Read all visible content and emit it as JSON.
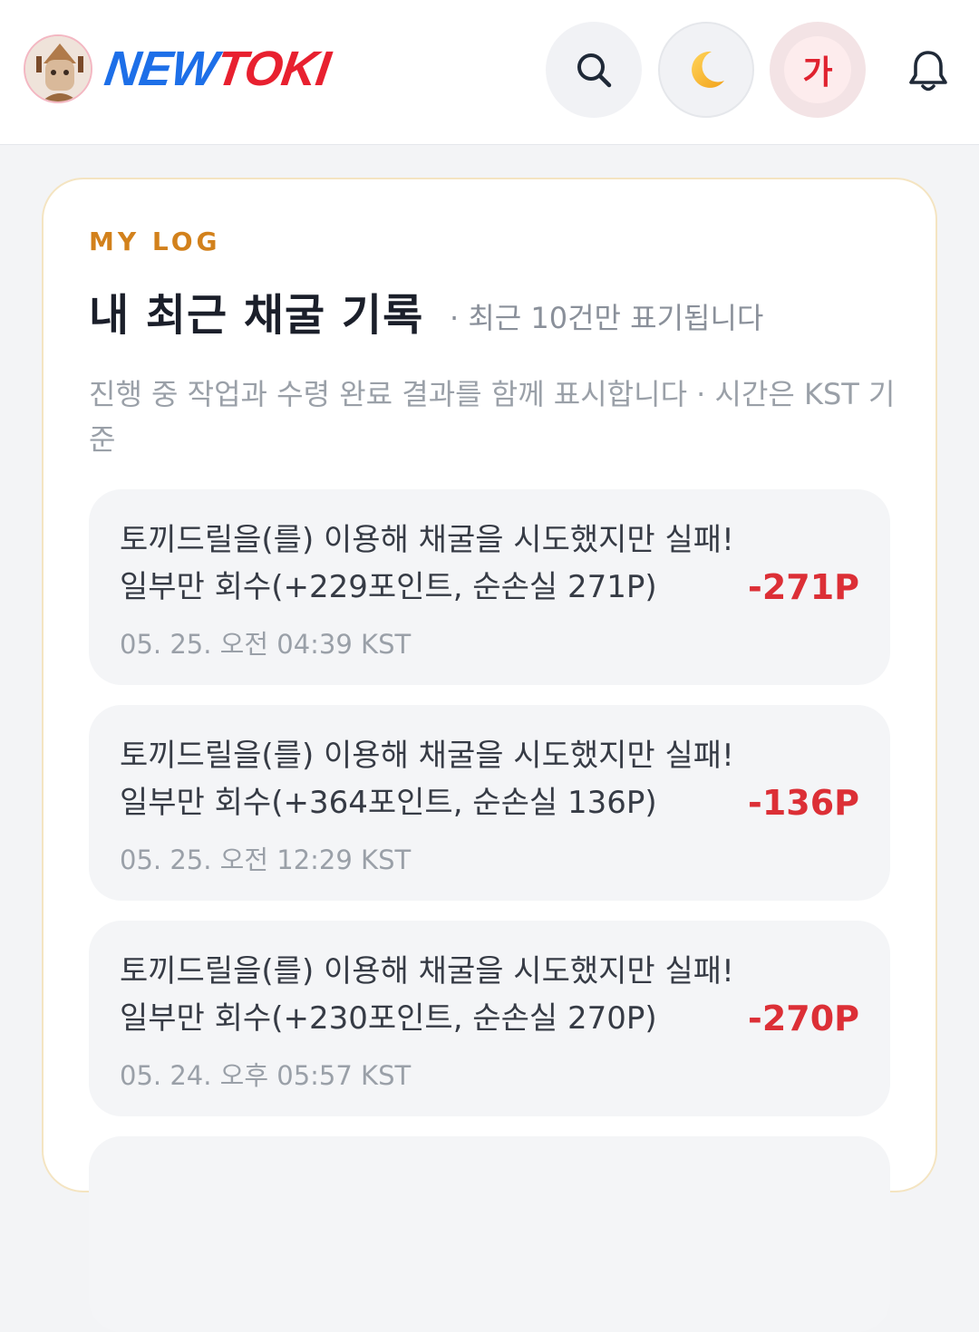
{
  "header": {
    "logo_new": "NEW",
    "logo_toki": "TOKI",
    "search_icon": "search-icon",
    "theme_icon": "moon-icon",
    "font_button_label": "가",
    "notification_icon": "bell-icon"
  },
  "log": {
    "eyebrow": "MY LOG",
    "title": "내 최근 채굴 기록",
    "title_note": "· 최근 10건만 표기됩니다",
    "description": "진행 중 작업과 수령 완료 결과를 함께 표시합니다 · 시간은 KST 기준",
    "items": [
      {
        "text": "토끼드릴을(를) 이용해 채굴을 시도했지만 실패! 일부만 회수(+229포인트, 순손실 271P)",
        "time": "05. 25. 오전 04:39 KST",
        "amount": "-271P"
      },
      {
        "text": "토끼드릴을(를) 이용해 채굴을 시도했지만 실패! 일부만 회수(+364포인트, 순손실 136P)",
        "time": "05. 25. 오전 12:29 KST",
        "amount": "-136P"
      },
      {
        "text": "토끼드릴을(를) 이용해 채굴을 시도했지만 실패! 일부만 회수(+230포인트, 순손실 270P)",
        "time": "05. 24. 오후 05:57 KST",
        "amount": "-270P"
      }
    ]
  },
  "colors": {
    "accent_orange": "#d2811c",
    "loss_red": "#dc2f36",
    "logo_blue": "#1d6fe8",
    "logo_red": "#e8202f"
  }
}
